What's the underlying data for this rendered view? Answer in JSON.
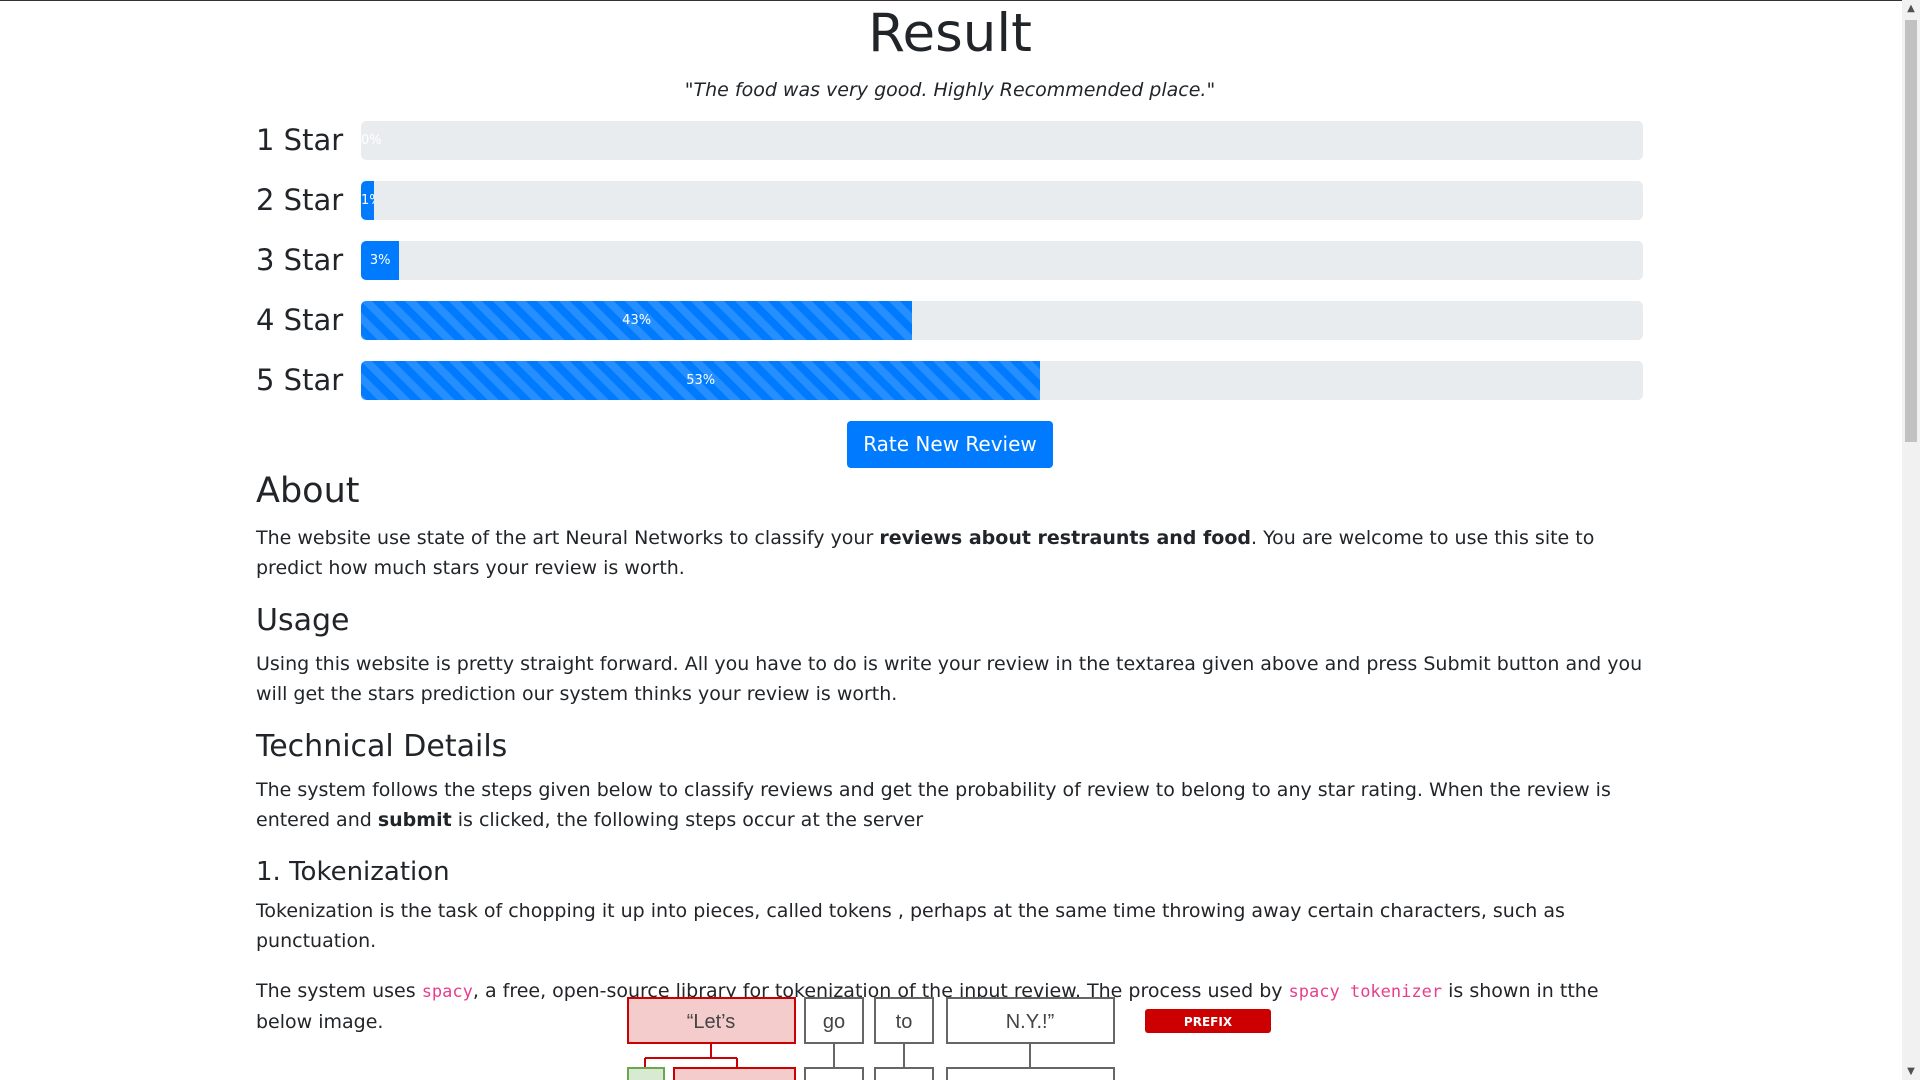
{
  "page": {
    "title": "Result",
    "review_quote": "\"The food was very good. Highly Recommended place.\""
  },
  "ratings": [
    {
      "label": "1 Star",
      "percent": 0,
      "percent_text": "0%"
    },
    {
      "label": "2 Star",
      "percent": 1,
      "percent_text": "1%"
    },
    {
      "label": "3 Star",
      "percent": 3,
      "percent_text": "3%"
    },
    {
      "label": "4 Star",
      "percent": 43,
      "percent_text": "43%"
    },
    {
      "label": "5 Star",
      "percent": 53,
      "percent_text": "53%"
    }
  ],
  "rate_button": {
    "label": "Rate New Review"
  },
  "about": {
    "heading": "About",
    "text_before": "The website use state of the art Neural Networks to classify your ",
    "text_bold": "reviews about restraunts and food",
    "text_after": ". You are welcome to use this site to predict how much stars your review is worth."
  },
  "usage": {
    "heading": "Usage",
    "text": "Using this website is pretty straight forward. All you have to do is write your review in the textarea given above and press Submit button and you will get the stars prediction our system thinks your review is worth."
  },
  "technical": {
    "heading": "Technical Details",
    "text_before": "The system follows the steps given below to classify reviews and get the probability of review to belong to any star rating. When the review is entered and ",
    "text_bold": "submit",
    "text_after": " is clicked, the following steps occur at the server"
  },
  "tokenization": {
    "heading": "1. Tokenization",
    "para1": "Tokenization is the task of chopping it up into pieces, called tokens , perhaps at the same time throwing away certain characters, such as punctuation.",
    "para2_a": "The system uses ",
    "para2_code1": "spacy",
    "para2_b": ", a free, open-source library for tokenization of the input review. The process used by ",
    "para2_code2": "spacy tokenizer",
    "para2_c": " is shown in tthe below image."
  },
  "diagram": {
    "tokens": [
      "“Let’s",
      "go",
      "to",
      "N.Y.!”"
    ],
    "tag": "PREFIX"
  },
  "colors": {
    "primary": "#007bff",
    "progress_track": "#e9ecef",
    "code": "#e83e8c",
    "prefix_red": "#cc0000",
    "token_highlight_fill": "#f4cccc",
    "token_highlight_border": "#cc0000"
  }
}
